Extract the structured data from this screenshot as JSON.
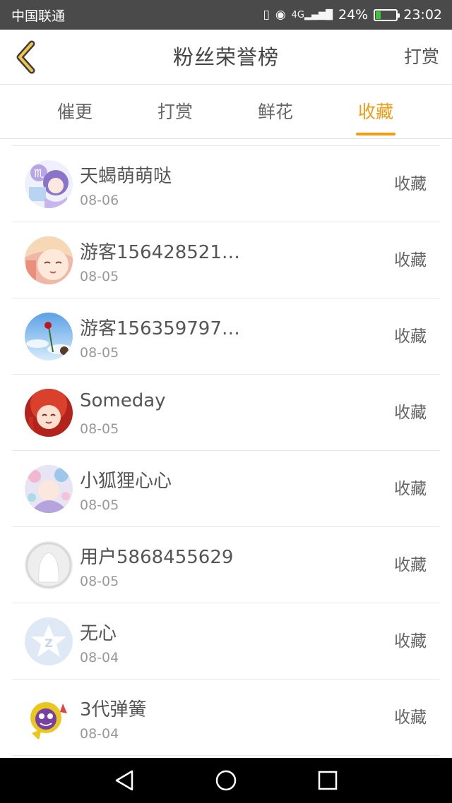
{
  "status": {
    "carrier": "中国联通",
    "battery": "24%",
    "time": "23:02",
    "battery_level": 0.24,
    "network": "4G"
  },
  "header": {
    "title": "粉丝荣誉榜",
    "action": "打赏"
  },
  "tabs": [
    {
      "label": "催更",
      "active": false
    },
    {
      "label": "打赏",
      "active": false
    },
    {
      "label": "鲜花",
      "active": false
    },
    {
      "label": "收藏",
      "active": true
    }
  ],
  "colors": {
    "accent": "#f39b15",
    "statusbar": "#4a4a4a",
    "navbar": "#000000"
  },
  "fans": [
    {
      "name": "天蝎萌萌哒",
      "date": "08-06",
      "action": "收藏",
      "avatar": "anime-girl-purple-avatar"
    },
    {
      "name": "游客1564285211...",
      "date": "08-05",
      "action": "收藏",
      "avatar": "anime-sleepy-avatar"
    },
    {
      "name": "游客1563597978...",
      "date": "08-05",
      "action": "收藏",
      "avatar": "rose-sky-avatar"
    },
    {
      "name": "Someday",
      "date": "08-05",
      "action": "收藏",
      "avatar": "anime-redhair-avatar"
    },
    {
      "name": "小狐狸心心",
      "date": "08-05",
      "action": "收藏",
      "avatar": "anime-colorful-avatar"
    },
    {
      "name": "用户5868455629",
      "date": "08-05",
      "action": "收藏",
      "avatar": "default-user-avatar"
    },
    {
      "name": "无心",
      "date": "08-04",
      "action": "收藏",
      "avatar": "qq-star-avatar"
    },
    {
      "name": "3代弹簧",
      "date": "08-04",
      "action": "收藏",
      "avatar": "cartoon-yellow-avatar"
    }
  ],
  "navbar": {
    "icons": [
      "back-triangle-icon",
      "home-circle-icon",
      "recents-square-icon"
    ]
  }
}
